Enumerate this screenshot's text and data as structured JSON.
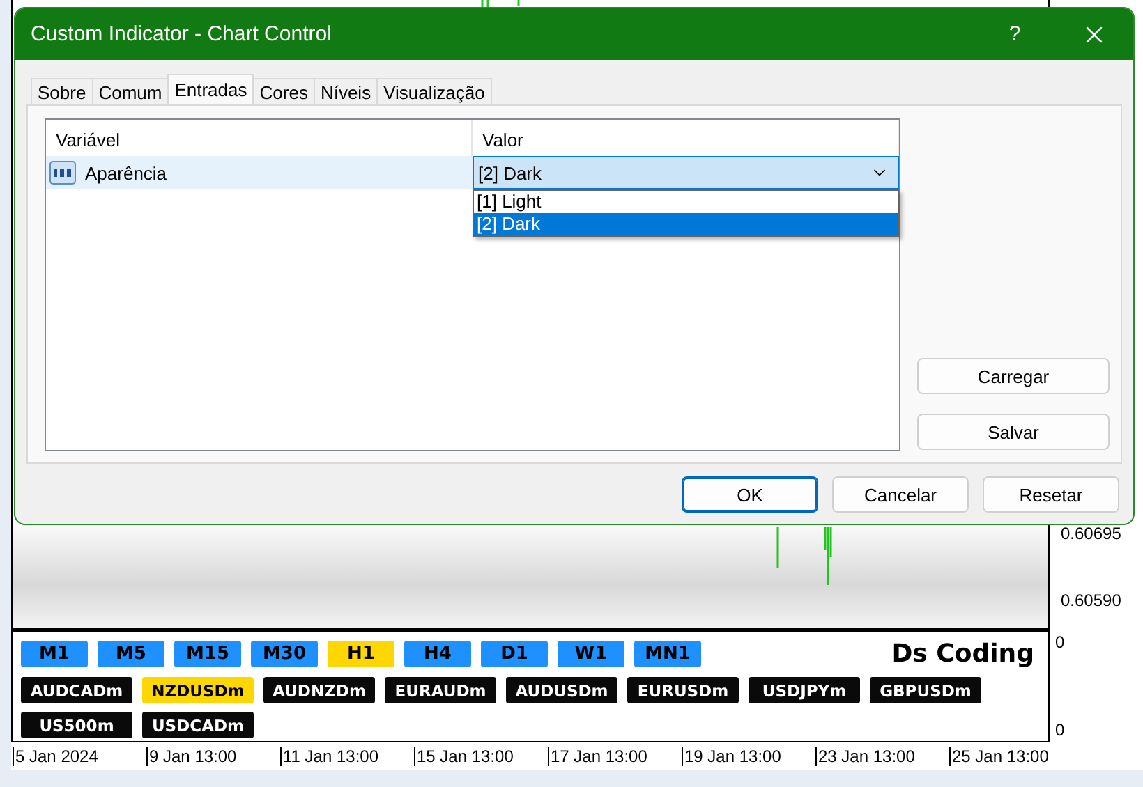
{
  "window": {
    "title": "Custom Indicator - Chart Control",
    "help": "?"
  },
  "tabs": [
    {
      "label": "Sobre",
      "selected": false
    },
    {
      "label": "Comum",
      "selected": false
    },
    {
      "label": "Entradas",
      "selected": true
    },
    {
      "label": "Cores",
      "selected": false
    },
    {
      "label": "Níveis",
      "selected": false
    },
    {
      "label": "Visualização",
      "selected": false
    }
  ],
  "table": {
    "columns": [
      "Variável",
      "Valor"
    ],
    "rows": [
      {
        "name": "Aparência",
        "value": "[2] Dark",
        "selected": true
      }
    ]
  },
  "dropdown": {
    "options": [
      {
        "label": "[1] Light",
        "selected": false
      },
      {
        "label": "[2] Dark",
        "selected": true
      }
    ]
  },
  "side_buttons": [
    "Carregar",
    "Salvar"
  ],
  "buttons": [
    {
      "label": "OK",
      "default": true
    },
    {
      "label": "Cancelar",
      "default": false
    },
    {
      "label": "Resetar",
      "default": false
    }
  ],
  "chart": {
    "price_labels": [
      "0.60695",
      "0.60590"
    ],
    "indicator_axis": [
      "0",
      "0"
    ],
    "brand": "Ds Coding",
    "timeframes": [
      {
        "label": "M1",
        "selected": false
      },
      {
        "label": "M5",
        "selected": false
      },
      {
        "label": "M15",
        "selected": false
      },
      {
        "label": "M30",
        "selected": false
      },
      {
        "label": "H1",
        "selected": true
      },
      {
        "label": "H4",
        "selected": false
      },
      {
        "label": "D1",
        "selected": false
      },
      {
        "label": "W1",
        "selected": false
      },
      {
        "label": "MN1",
        "selected": false
      }
    ],
    "symbols": [
      {
        "label": "AUDCADm",
        "selected": false
      },
      {
        "label": "NZDUSDm",
        "selected": true
      },
      {
        "label": "AUDNZDm",
        "selected": false
      },
      {
        "label": "EURAUDm",
        "selected": false
      },
      {
        "label": "AUDUSDm",
        "selected": false
      },
      {
        "label": "EURUSDm",
        "selected": false
      },
      {
        "label": "USDJPYm",
        "selected": false
      },
      {
        "label": "GBPUSDm",
        "selected": false
      },
      {
        "label": "US500m",
        "selected": false
      },
      {
        "label": "USDCADm",
        "selected": false
      }
    ],
    "dates": [
      "5 Jan 2024",
      "9 Jan 13:00",
      "11 Jan 13:00",
      "15 Jan 13:00",
      "17 Jan 13:00",
      "19 Jan 13:00",
      "23 Jan 13:00",
      "25 Jan 13:00"
    ]
  }
}
